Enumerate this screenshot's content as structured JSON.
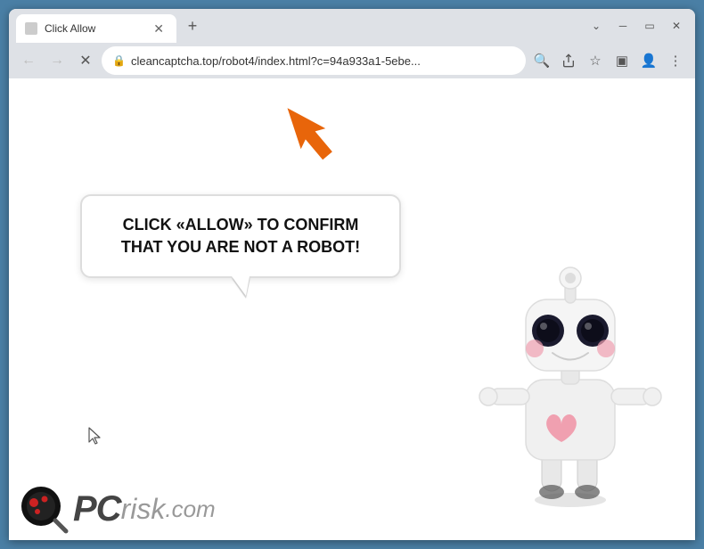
{
  "window": {
    "title": "Click Allow",
    "tab_label": "Click Allow",
    "new_tab_tooltip": "New tab",
    "minimize_label": "Minimize",
    "maximize_label": "Maximize",
    "close_label": "Close"
  },
  "browser": {
    "url": "cleancaptcha.top/robot4/index.html?c=94a933a1-5ebe...",
    "back_enabled": false,
    "forward_enabled": false
  },
  "toolbar": {
    "search_icon_label": "Search",
    "share_icon_label": "Share",
    "bookmark_icon_label": "Bookmark",
    "desktop_icon_label": "Desktop",
    "profile_icon_label": "Profile",
    "menu_icon_label": "Menu"
  },
  "page": {
    "bubble_text": "CLICK «ALLOW» TO CONFIRM THAT YOU ARE NOT A ROBOT!",
    "arrow_color": "#E8650A"
  },
  "logo": {
    "pc_text": "PC",
    "risk_text": "risk",
    "dot_com_text": ".com"
  }
}
